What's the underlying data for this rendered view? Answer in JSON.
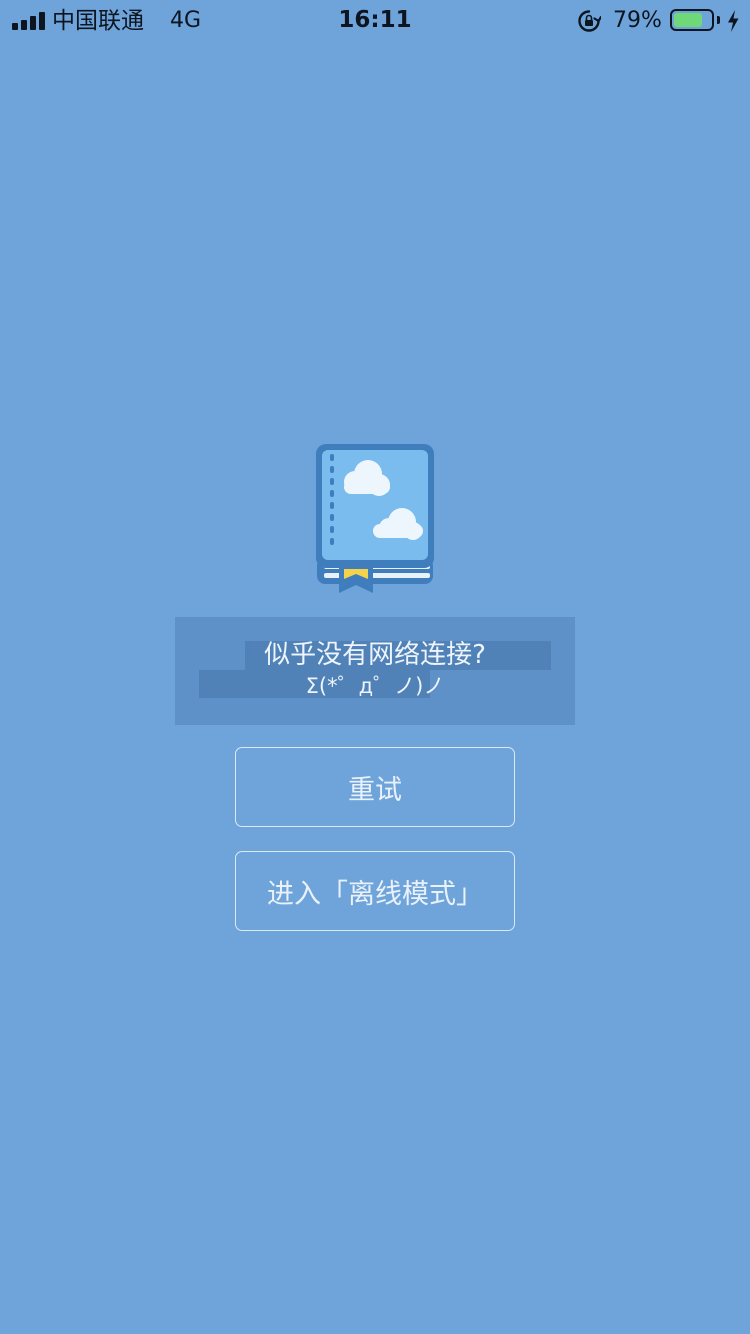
{
  "theme": {
    "background": "#6fa4da",
    "status_text": "#0d1520",
    "battery_fill": "#6fd878",
    "book_cover": "#7bbcef",
    "book_border": "#3f7dbd",
    "bookmark": "#f3d24c"
  },
  "status_bar": {
    "carrier": "中国联通",
    "network": "4G",
    "time": "16:11",
    "battery_percent": "79%",
    "battery_level": 0.79,
    "icons": [
      "signal-icon",
      "rotation-lock-icon",
      "battery-icon",
      "charging-bolt-icon"
    ]
  },
  "illustration": {
    "icon": "book-with-clouds-icon"
  },
  "message": {
    "line1": "似乎没有网络连接?",
    "line2": "Σ(*゜д゜ノ)ノ"
  },
  "buttons": {
    "retry_label": "重试",
    "offline_label": "进入「离线模式」"
  }
}
